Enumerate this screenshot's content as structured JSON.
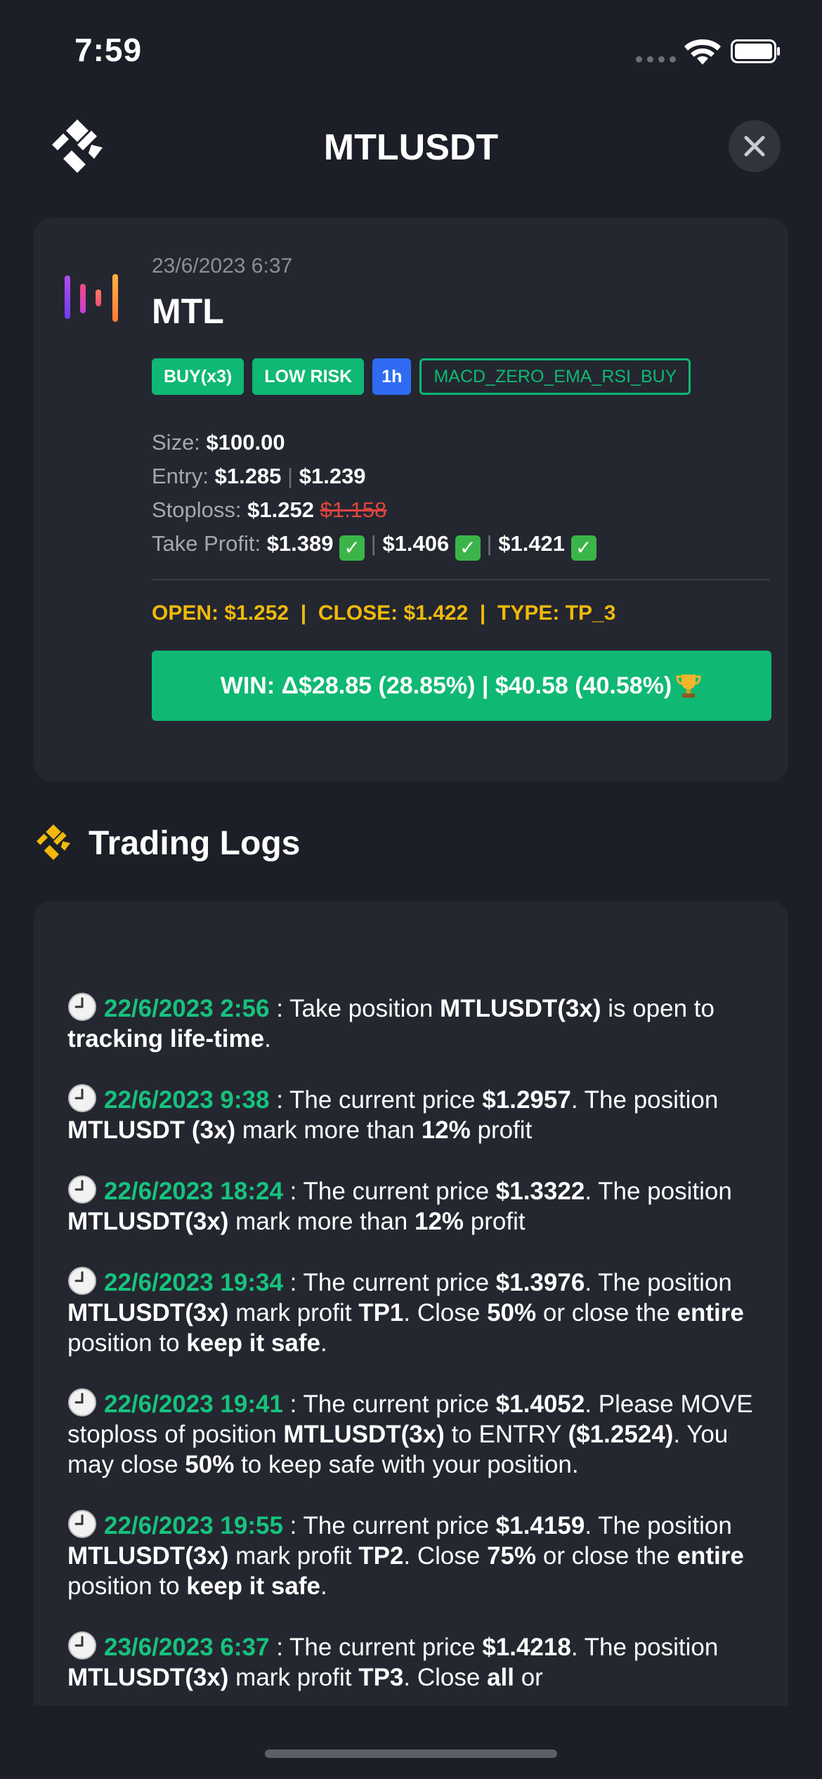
{
  "status_bar": {
    "time": "7:59"
  },
  "header": {
    "title": "MTLUSDT"
  },
  "signal_card": {
    "date": "23/6/2023 6:37",
    "symbol": "MTL",
    "tags": [
      "BUY(x3)",
      "LOW RISK",
      "1h",
      "MACD_ZERO_EMA_RSI_BUY"
    ],
    "size_label": "Size:",
    "size_value": "$100.00",
    "entry_label": "Entry:",
    "entry_values": [
      "$1.285",
      "$1.239"
    ],
    "stoploss_label": "Stoploss:",
    "stoploss_value": "$1.252",
    "stoploss_old": "$1.158",
    "tp_label": "Take Profit:",
    "tp_values": [
      "$1.389",
      "$1.406",
      "$1.421"
    ],
    "summary": "OPEN: $1.252  |  CLOSE: $1.422  |  TYPE: TP_3",
    "result": "WIN: Δ$28.85 (28.85%) | $40.58 (40.58%)"
  },
  "logs": {
    "title": "Trading Logs",
    "entries": [
      {
        "time": "22/6/2023 2:56",
        "parts": [
          " : Take position ",
          "MTLUSDT(3x)",
          " is open to ",
          "tracking life-time",
          "."
        ]
      },
      {
        "time": "22/6/2023 9:38",
        "parts": [
          " : The current price ",
          "$1.2957",
          ". The position ",
          "MTLUSDT (3x)",
          " mark more than ",
          "12%",
          " profit"
        ]
      },
      {
        "time": "22/6/2023 18:24",
        "parts": [
          " : The current price ",
          "$1.3322",
          ". The position ",
          "MTLUSDT(3x)",
          " mark more than ",
          "12%",
          " profit"
        ]
      },
      {
        "time": "22/6/2023 19:34",
        "parts": [
          " : The current price ",
          "$1.3976",
          ". The position ",
          "MTLUSDT(3x)",
          " mark profit ",
          "TP1",
          ". Close ",
          "50%",
          " or close the ",
          "entire",
          " position to ",
          "keep it safe",
          "."
        ]
      },
      {
        "time": "22/6/2023 19:41",
        "parts": [
          " : The current price ",
          "$1.4052",
          ". Please MOVE stoploss of position ",
          "MTLUSDT(3x)",
          " to ENTRY ",
          "($1.2524)",
          ". You may close ",
          "50%",
          " to keep safe with your position."
        ]
      },
      {
        "time": "22/6/2023 19:55",
        "parts": [
          " : The current price ",
          "$1.4159",
          ". The position ",
          "MTLUSDT(3x)",
          " mark profit ",
          "TP2",
          ". Close ",
          "75%",
          " or close the ",
          "entire",
          " position to ",
          "keep it safe",
          "."
        ]
      },
      {
        "time": "23/6/2023 6:37",
        "parts": [
          " : The current price ",
          "$1.4218",
          ". The position ",
          "MTLUSDT(3x)",
          " mark profit ",
          "TP3",
          ". Close ",
          "all",
          " or"
        ]
      }
    ]
  },
  "colors": {
    "background": "#1c1f27",
    "card": "#242730",
    "accent_green": "#0fb873",
    "accent_yellow": "#f0b90b",
    "tag_blue": "#2f6bf2",
    "loss_red": "#e0443f"
  },
  "icons": [
    "wifi-icon",
    "battery-icon",
    "app-logo-icon",
    "close-icon",
    "coin-logo-icon",
    "check-icon",
    "trophy-icon",
    "clock-icon"
  ]
}
